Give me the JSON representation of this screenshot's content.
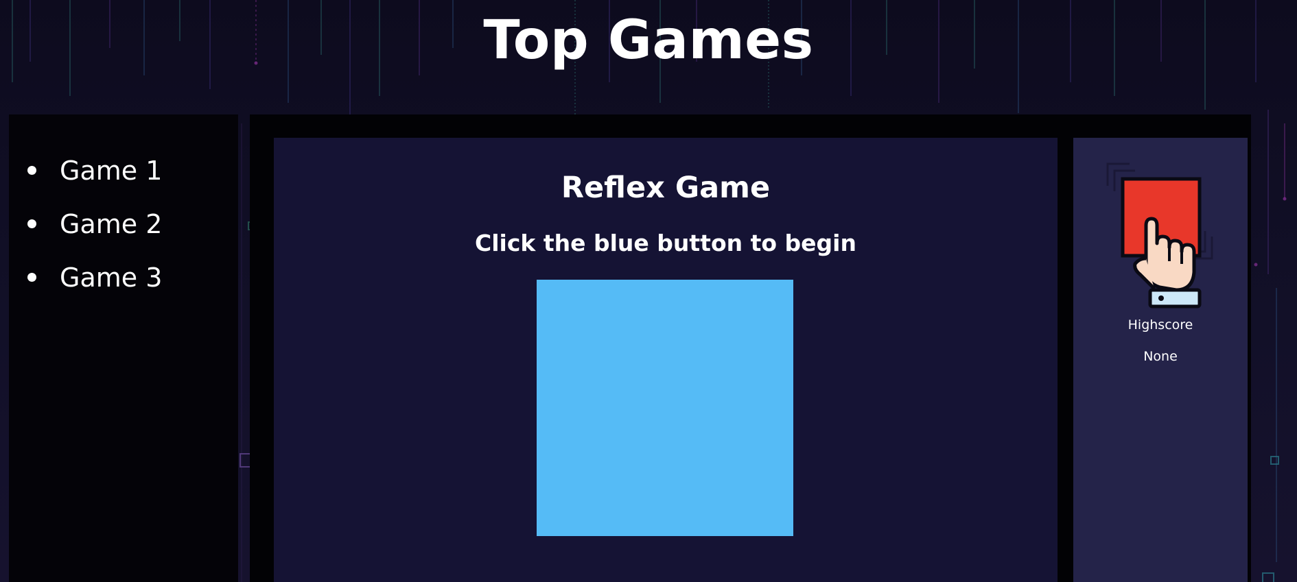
{
  "header": {
    "title": "Top Games"
  },
  "sidebar": {
    "items": [
      {
        "label": "Game 1"
      },
      {
        "label": "Game 2"
      },
      {
        "label": "Game 3"
      }
    ]
  },
  "game": {
    "title": "Reflex Game",
    "instruction": "Click the blue button to begin",
    "button_color": "#55bbf6"
  },
  "score_panel": {
    "icon": "hand-pressing-button-icon",
    "label": "Highscore",
    "value": "None"
  },
  "colors": {
    "page_background": "#0d0b1c",
    "sidebar_background": "#040308",
    "game_panel_background": "#151334",
    "score_panel_background": "#242349",
    "icon_button_red": "#e8372a"
  }
}
